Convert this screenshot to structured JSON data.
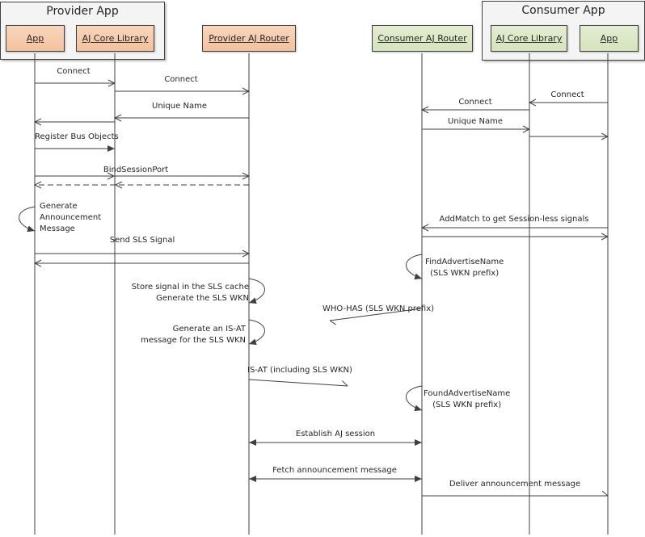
{
  "groups": {
    "provider": {
      "title": "Provider App"
    },
    "consumer": {
      "title": "Consumer App"
    }
  },
  "actors": [
    {
      "id": "p_app",
      "label": "App",
      "side": "provider"
    },
    {
      "id": "p_core",
      "label": "AJ Core Library",
      "side": "provider"
    },
    {
      "id": "p_router",
      "label": "Provider AJ Router",
      "side": "provider"
    },
    {
      "id": "c_router",
      "label": "Consumer AJ Router",
      "side": "consumer"
    },
    {
      "id": "c_core",
      "label": "AJ Core Library",
      "side": "consumer"
    },
    {
      "id": "c_app",
      "label": "App",
      "side": "consumer"
    }
  ],
  "colors": {
    "provider_fill": "#f3c19d",
    "consumer_fill": "#d6e3bc",
    "line": "#3f3f3f"
  },
  "messages": [
    {
      "label": "Connect",
      "from": "p_app",
      "to": "p_core",
      "style": "open"
    },
    {
      "label": "Connect",
      "from": "p_core",
      "to": "p_router",
      "style": "open"
    },
    {
      "label": "Unique Name",
      "from": "p_router",
      "to": "p_core",
      "style": "open"
    },
    {
      "label": "",
      "from": "p_core",
      "to": "p_app",
      "style": "open"
    },
    {
      "label": "Register Bus Objects",
      "from": "p_app",
      "to": "p_core",
      "style": "filled"
    },
    {
      "label": "BindSessionPort",
      "from": "p_app",
      "to": "p_router",
      "style": "open"
    },
    {
      "label": "",
      "from": "p_router",
      "to": "p_app",
      "style": "dashed"
    },
    {
      "label": "Connect",
      "from": "c_app",
      "to": "c_core",
      "style": "open"
    },
    {
      "label": "Connect",
      "from": "c_core",
      "to": "c_router",
      "style": "open"
    },
    {
      "label": "Unique Name",
      "from": "c_router",
      "to": "c_core",
      "style": "open"
    },
    {
      "label": "",
      "from": "c_core",
      "to": "c_app",
      "style": "open"
    },
    {
      "label": "Send SLS Signal",
      "from": "p_app",
      "to": "p_router",
      "style": "open"
    },
    {
      "label": "",
      "from": "p_router",
      "to": "p_app",
      "style": "open"
    },
    {
      "label": "AddMatch to get Session-less signals",
      "from": "c_app",
      "to": "c_router",
      "style": "open"
    },
    {
      "label": "",
      "from": "c_router",
      "to": "c_app",
      "style": "open"
    },
    {
      "label": "WHO-HAS (SLS WKN prefix)",
      "from": "c_router",
      "to": "broadcast",
      "style": "half"
    },
    {
      "label": "IS-AT (including SLS WKN)",
      "from": "p_router",
      "to": "broadcast",
      "style": "half"
    },
    {
      "label": "Establish AJ session",
      "from": "p_router",
      "to": "c_router",
      "style": "both"
    },
    {
      "label": "Fetch announcement message",
      "from": "p_router",
      "to": "c_router",
      "style": "both"
    },
    {
      "label": "Deliver announcement message",
      "from": "c_router",
      "to": "c_app",
      "style": "half"
    }
  ],
  "self_calls": [
    {
      "actor": "p_app",
      "lines": [
        "Generate",
        "Announcement",
        "Message"
      ]
    },
    {
      "actor": "c_router",
      "lines": [
        "FindAdvertiseName",
        "(SLS WKN prefix)"
      ]
    },
    {
      "actor": "p_router",
      "lines": [
        "Store signal in the SLS cache",
        "Generate the SLS WKN"
      ]
    },
    {
      "actor": "p_router",
      "lines": [
        "Generate an IS-AT",
        "message  for the SLS WKN"
      ]
    },
    {
      "actor": "c_router",
      "lines": [
        "FoundAdvertiseName",
        "(SLS WKN prefix)"
      ]
    }
  ]
}
